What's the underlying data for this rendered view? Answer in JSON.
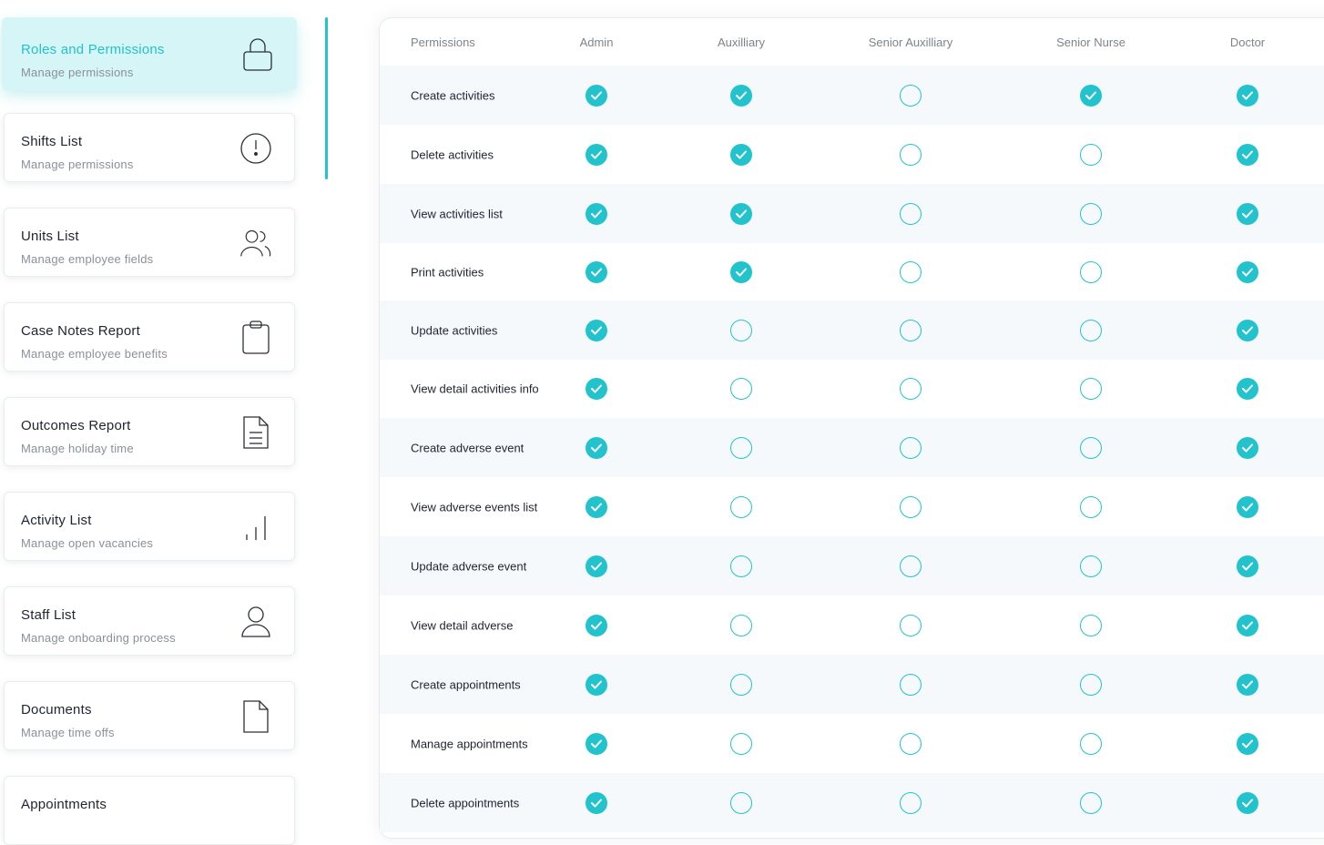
{
  "sidebar": {
    "items": [
      {
        "title": "Roles and Permissions",
        "subtitle": "Manage permissions",
        "icon": "lock-icon",
        "active": true
      },
      {
        "title": "Shifts List",
        "subtitle": "Manage permissions",
        "icon": "alert-icon",
        "active": false
      },
      {
        "title": "Units List",
        "subtitle": "Manage employee fields",
        "icon": "users-icon",
        "active": false
      },
      {
        "title": "Case Notes Report",
        "subtitle": "Manage  employee benefits",
        "icon": "clipboard-icon",
        "active": false
      },
      {
        "title": "Outcomes Report",
        "subtitle": "Manage holiday time",
        "icon": "document-lines-icon",
        "active": false
      },
      {
        "title": "Activity List",
        "subtitle": "Manage open vacancies",
        "icon": "bar-chart-icon",
        "active": false
      },
      {
        "title": "Staff List",
        "subtitle": "Manage onboarding process",
        "icon": "user-icon",
        "active": false
      },
      {
        "title": "Documents",
        "subtitle": "Manage time offs",
        "icon": "file-icon",
        "active": false
      },
      {
        "title": "Appointments",
        "subtitle": "",
        "icon": "",
        "active": false
      }
    ]
  },
  "table": {
    "headers": [
      "Permissions",
      "Admin",
      "Auxilliary",
      "Senior Auxilliary",
      "Senior Nurse",
      "Doctor"
    ],
    "rows": [
      {
        "label": "Create activities",
        "values": [
          true,
          true,
          false,
          true,
          true
        ]
      },
      {
        "label": "Delete activities",
        "values": [
          true,
          true,
          false,
          false,
          true
        ]
      },
      {
        "label": "View activities list",
        "values": [
          true,
          true,
          false,
          false,
          true
        ]
      },
      {
        "label": "Print activities",
        "values": [
          true,
          true,
          false,
          false,
          true
        ]
      },
      {
        "label": "Update activities",
        "values": [
          true,
          false,
          false,
          false,
          true
        ]
      },
      {
        "label": "View detail activities info",
        "values": [
          true,
          false,
          false,
          false,
          true
        ]
      },
      {
        "label": "Create adverse event",
        "values": [
          true,
          false,
          false,
          false,
          true
        ]
      },
      {
        "label": "View adverse events list",
        "values": [
          true,
          false,
          false,
          false,
          true
        ]
      },
      {
        "label": "Update adverse event",
        "values": [
          true,
          false,
          false,
          false,
          true
        ]
      },
      {
        "label": "View detail adverse",
        "values": [
          true,
          false,
          false,
          false,
          true
        ]
      },
      {
        "label": "Create appointments",
        "values": [
          true,
          false,
          false,
          false,
          true
        ]
      },
      {
        "label": "Manage appointments",
        "values": [
          true,
          false,
          false,
          false,
          true
        ]
      },
      {
        "label": "Delete appointments",
        "values": [
          true,
          false,
          false,
          false,
          true
        ]
      }
    ]
  },
  "colors": {
    "accent": "#22c3cc",
    "active_card_bg": "#d6f5f6",
    "row_shade": "#f5f9fc"
  }
}
